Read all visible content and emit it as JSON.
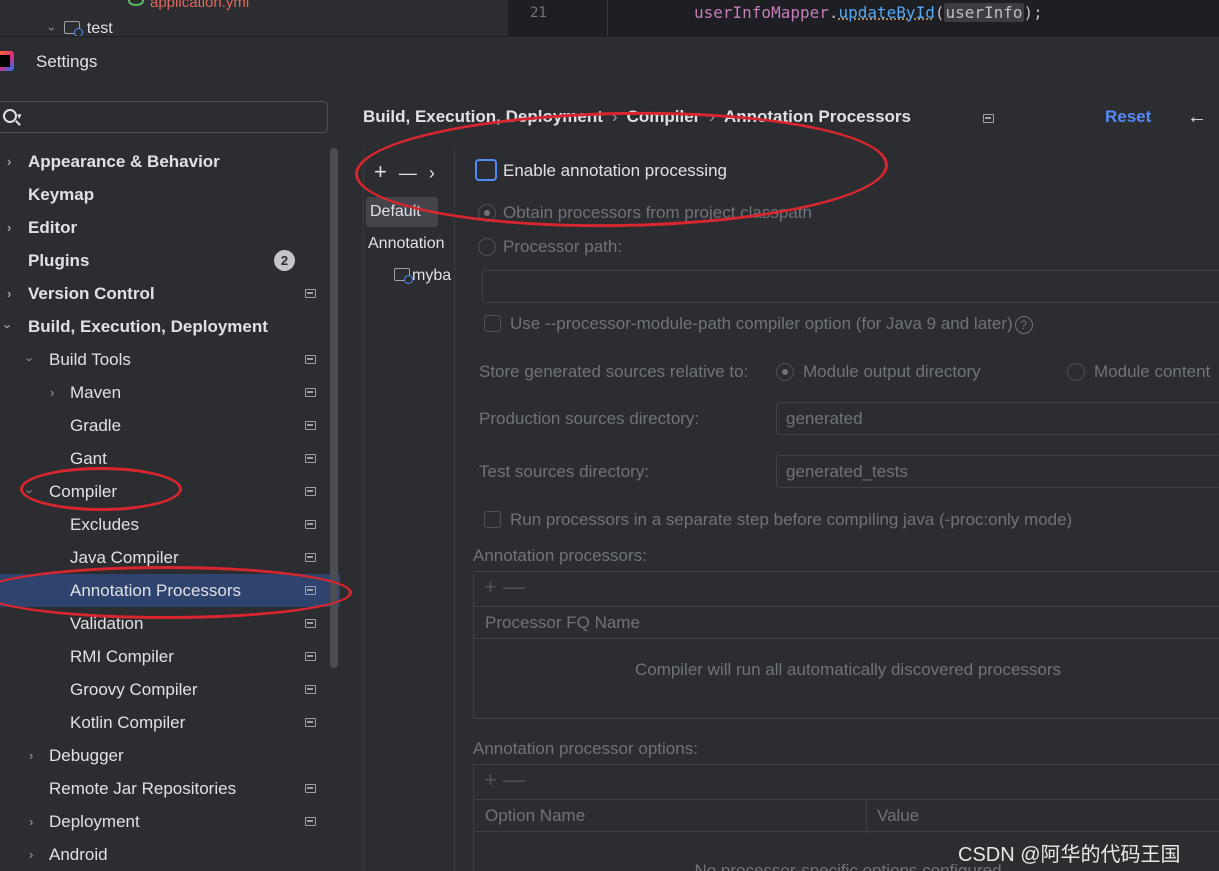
{
  "editor": {
    "file_name": "application.yml",
    "folder_label": "test",
    "line_number": "21",
    "code_object": "userInfoMapper",
    "code_method": "updateById",
    "code_arg": "userInfo",
    "code_open": "(",
    "code_close": ");",
    "code_dot": "."
  },
  "window": {
    "title": "Settings"
  },
  "search": {
    "placeholder": ""
  },
  "nav": {
    "items": [
      {
        "label": "Appearance & Behavior"
      },
      {
        "label": "Keymap"
      },
      {
        "label": "Editor"
      },
      {
        "label": "Plugins",
        "badge": "2"
      },
      {
        "label": "Version Control"
      },
      {
        "label": "Build, Execution, Deployment"
      },
      {
        "label": "Build Tools"
      },
      {
        "label": "Maven"
      },
      {
        "label": "Gradle"
      },
      {
        "label": "Gant"
      },
      {
        "label": "Compiler"
      },
      {
        "label": "Excludes"
      },
      {
        "label": "Java Compiler"
      },
      {
        "label": "Annotation Processors"
      },
      {
        "label": "Validation"
      },
      {
        "label": "RMI Compiler"
      },
      {
        "label": "Groovy Compiler"
      },
      {
        "label": "Kotlin Compiler"
      },
      {
        "label": "Debugger"
      },
      {
        "label": "Remote Jar Repositories"
      },
      {
        "label": "Deployment"
      },
      {
        "label": "Android"
      }
    ]
  },
  "breadcrumb": {
    "part1": "Build, Execution, Deployment",
    "part2": "Compiler",
    "part3": "Annotation Processors",
    "sep": "›"
  },
  "actions": {
    "reset": "Reset",
    "back": "←"
  },
  "profiles": {
    "toolbar": {
      "add": "+",
      "remove": "—",
      "more": "›"
    },
    "items": [
      "Default",
      "Annotation",
      "myba"
    ]
  },
  "form": {
    "enable_label": "Enable annotation processing",
    "obtain_label": "Obtain processors from project classpath",
    "processor_path_label": "Processor path:",
    "processor_path_value": "",
    "module_path_label": "Use --processor-module-path compiler option (for Java 9 and later)",
    "help": "?",
    "store_label": "Store generated sources relative to:",
    "store_opt1": "Module output directory",
    "store_opt2": "Module content",
    "prod_dir_label": "Production sources directory:",
    "prod_dir_value": "generated",
    "test_dir_label": "Test sources directory:",
    "test_dir_value": "generated_tests",
    "separate_step_label": "Run processors in a separate step before compiling java (-proc:only mode)"
  },
  "processors_table": {
    "section_label": "Annotation processors:",
    "toolbar": "+  —",
    "column": "Processor FQ Name",
    "empty_text": "Compiler will run all automatically discovered processors"
  },
  "options_table": {
    "section_label": "Annotation processor options:",
    "toolbar": "+  —",
    "col_name": "Option Name",
    "col_value": "Value",
    "empty_text": "No processor-specific options configured"
  },
  "watermark": "CSDN @阿华的代码王国",
  "colors": {
    "accent": "#548af7",
    "selection": "#2e436e",
    "annotation": "#d8262f",
    "background": "#2b2d30"
  }
}
